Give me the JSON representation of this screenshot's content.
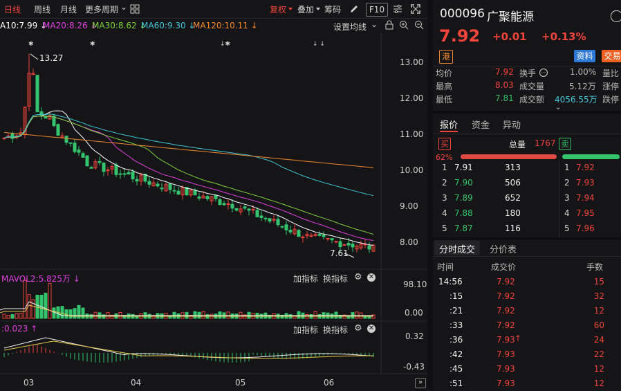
{
  "toolbar": {
    "periods": [
      "日线",
      "周线",
      "月线",
      "更多周期"
    ],
    "more_arrow": "⌄",
    "adjust": "复权",
    "overlay": "叠加",
    "chips": "筹码",
    "f10": "F10",
    "icons": [
      "grid-icon",
      "pen-icon",
      "settings-sliders-icon",
      "expand-icon"
    ]
  },
  "ma_legend": {
    "items": [
      {
        "label": "A10:7.99 ↓",
        "color": "#ffffff"
      },
      {
        "label": "MA20:8.26 ↓",
        "color": "#e040e0"
      },
      {
        "label": "MA30:8.62 ↓",
        "color": "#7fd03a"
      },
      {
        "label": "MA60:9.30 ↓",
        "color": "#3fc6d6"
      },
      {
        "label": "MA120:10.11 ↓",
        "color": "#f08a30"
      }
    ],
    "settings": "设置均线",
    "settings_arrow": "⌄"
  },
  "price_axis": [
    "13.00",
    "12.00",
    "11.00",
    "10.00",
    "9.00",
    "8.00"
  ],
  "annotations": {
    "high": "13.27",
    "low": "7.61"
  },
  "volume_panel": {
    "legend": "MAVOL2:5.825万 ↓",
    "add_indicator": "加指标",
    "switch_indicator": "换指标",
    "axis": [
      "98.10",
      "0.00"
    ]
  },
  "macd_panel": {
    "legend": ":0.023 ↑",
    "add_indicator": "加指标",
    "switch_indicator": "换指标",
    "axis": [
      "0.32",
      "-0.43"
    ]
  },
  "date_axis": [
    "03",
    "04",
    "05",
    "06"
  ],
  "stock": {
    "code": "000096",
    "name": "广聚能源",
    "price": "7.92",
    "change": "+0.01",
    "change_pct": "+0.13%",
    "market_tag": "港",
    "info_btn": "资料",
    "trade_btn": "交易"
  },
  "stats": [
    {
      "label": "均价",
      "value": "7.92",
      "label2": "换手",
      "value2": "1.00%",
      "label3": "量比"
    },
    {
      "label": "最高",
      "value": "8.03",
      "label2": "成交量",
      "value2": "5.12万",
      "label3": "涨停"
    },
    {
      "label": "最低",
      "value": "7.81",
      "label2": "成交额",
      "value2": "4056.55万",
      "label3": "跌停"
    }
  ],
  "tabs": [
    "报价",
    "资金",
    "异动"
  ],
  "order_book": {
    "buy_tag": "买",
    "sell_tag": "卖",
    "total_label": "总量",
    "total_value": "1767",
    "buy_pct": "62%",
    "buy_ratio": 0.62,
    "bids": [
      {
        "level": "1",
        "price": "7.91",
        "volume": "313"
      },
      {
        "level": "2",
        "price": "7.90",
        "volume": "506"
      },
      {
        "level": "3",
        "price": "7.89",
        "volume": "652"
      },
      {
        "level": "4",
        "price": "7.88",
        "volume": "180"
      },
      {
        "level": "5",
        "price": "7.87",
        "volume": "116"
      }
    ],
    "asks": [
      {
        "level": "1",
        "price": "7.92"
      },
      {
        "level": "2",
        "price": "7.93"
      },
      {
        "level": "3",
        "price": "7.94"
      },
      {
        "level": "4",
        "price": "7.95"
      },
      {
        "level": "5",
        "price": "7.96"
      }
    ]
  },
  "trades_tabs": [
    "分时成交",
    "分价表"
  ],
  "trades_header": [
    "时间",
    "成交价",
    "手数"
  ],
  "trades": [
    {
      "time": "14:56",
      "price": "7.92",
      "vol": "15",
      "up": false
    },
    {
      "time": ":15",
      "price": "7.92",
      "vol": "32",
      "up": false
    },
    {
      "time": ":21",
      "price": "7.92",
      "vol": "12",
      "up": false
    },
    {
      "time": ":33",
      "price": "7.92",
      "vol": "60",
      "up": false
    },
    {
      "time": ":36",
      "price": "7.93",
      "vol": "24",
      "up": true
    },
    {
      "time": ":42",
      "price": "7.93",
      "vol": "22",
      "up": false
    },
    {
      "time": ":45",
      "price": "7.93",
      "vol": "12",
      "up": false
    },
    {
      "time": ":51",
      "price": "7.93",
      "vol": "12",
      "up": false
    }
  ],
  "chart_data": {
    "type": "candlestick",
    "y_axis_ticks": [
      13.0,
      12.0,
      11.0,
      10.0,
      9.0,
      8.0
    ],
    "high_marker": 13.27,
    "low_marker": 7.61,
    "months": [
      "03",
      "04",
      "05",
      "06"
    ],
    "series": [
      {
        "name": "MA10",
        "last": 7.99,
        "color": "#ffffff"
      },
      {
        "name": "MA20",
        "last": 8.26,
        "color": "#e040e0"
      },
      {
        "name": "MA30",
        "last": 8.62,
        "color": "#7fd03a"
      },
      {
        "name": "MA60",
        "last": 9.3,
        "color": "#3fc6d6"
      },
      {
        "name": "MA120",
        "last": 10.11,
        "color": "#f08a30"
      }
    ]
  }
}
